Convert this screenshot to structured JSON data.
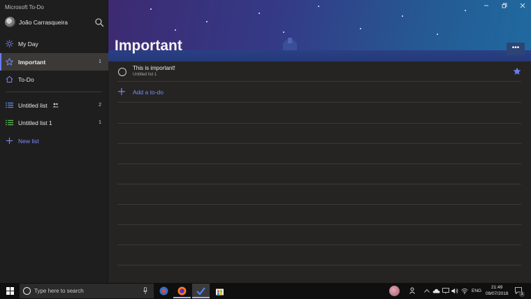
{
  "app": {
    "title": "Microsoft To-Do"
  },
  "profile": {
    "name": "João Carrasqueira"
  },
  "sidebar": {
    "items": [
      {
        "label": "My Day",
        "icon": "sun-icon",
        "count": ""
      },
      {
        "label": "Important",
        "icon": "star-outline-icon",
        "count": "1"
      },
      {
        "label": "To-Do",
        "icon": "home-icon",
        "count": ""
      }
    ],
    "lists": [
      {
        "label": "Untitled list",
        "icon": "list-icon",
        "shared": true,
        "count": "2",
        "color": "#5b8def"
      },
      {
        "label": "Untitled list 1",
        "icon": "list-icon",
        "shared": false,
        "count": "1",
        "color": "#5fb85a"
      }
    ],
    "new_list_label": "New list"
  },
  "main": {
    "title": "Important",
    "more_label": "•••",
    "tasks": [
      {
        "title": "This is important!",
        "subtitle": "Untitled list 1",
        "starred": true
      }
    ],
    "add_label": "Add a to-do"
  },
  "taskbar": {
    "search_placeholder": "Type here to search",
    "language": "ENG",
    "time": "21:49",
    "date": "09/07/2018",
    "notification_count": "1"
  },
  "colors": {
    "accent": "#7b8cf8",
    "sidebar_bg": "#1f1e1e",
    "content_bg": "#252423",
    "star": "#6a7cf6"
  }
}
